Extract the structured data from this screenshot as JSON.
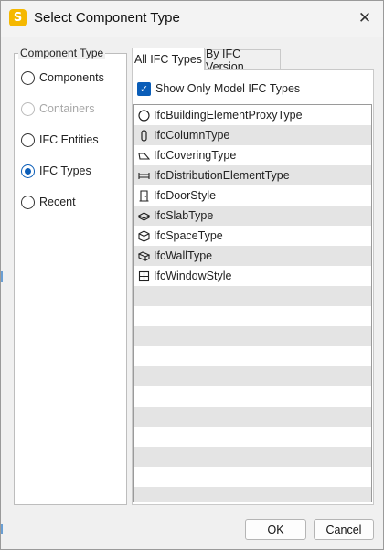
{
  "window": {
    "title": "Select Component Type",
    "app_icon_letter": "S",
    "close_glyph": "✕"
  },
  "component_type": {
    "legend": "Component Type",
    "options": [
      {
        "label": "Components",
        "checked": false,
        "disabled": false
      },
      {
        "label": "Containers",
        "checked": false,
        "disabled": true
      },
      {
        "label": "IFC Entities",
        "checked": false,
        "disabled": false
      },
      {
        "label": "IFC Types",
        "checked": true,
        "disabled": false
      },
      {
        "label": "Recent",
        "checked": false,
        "disabled": false
      }
    ]
  },
  "tabs": [
    {
      "label": "All IFC Types",
      "active": true
    },
    {
      "label": "By IFC Version",
      "active": false
    }
  ],
  "filter": {
    "label": "Show Only Model IFC Types",
    "checked": true,
    "check_glyph": "✓"
  },
  "ifc_types": [
    {
      "label": "IfcBuildingElementProxyType",
      "icon": "circle-icon"
    },
    {
      "label": "IfcColumnType",
      "icon": "column-icon"
    },
    {
      "label": "IfcCoveringType",
      "icon": "covering-icon"
    },
    {
      "label": "IfcDistributionElementType",
      "icon": "distribution-icon"
    },
    {
      "label": "IfcDoorStyle",
      "icon": "door-icon"
    },
    {
      "label": "IfcSlabType",
      "icon": "slab-icon"
    },
    {
      "label": "IfcSpaceType",
      "icon": "space-icon"
    },
    {
      "label": "IfcWallType",
      "icon": "wall-icon"
    },
    {
      "label": "IfcWindowStyle",
      "icon": "window-icon"
    }
  ],
  "buttons": {
    "ok": "OK",
    "cancel": "Cancel"
  },
  "colors": {
    "accent": "#0a5db8",
    "stripe": "#e4e4e4",
    "app_icon": "#f5b800"
  }
}
